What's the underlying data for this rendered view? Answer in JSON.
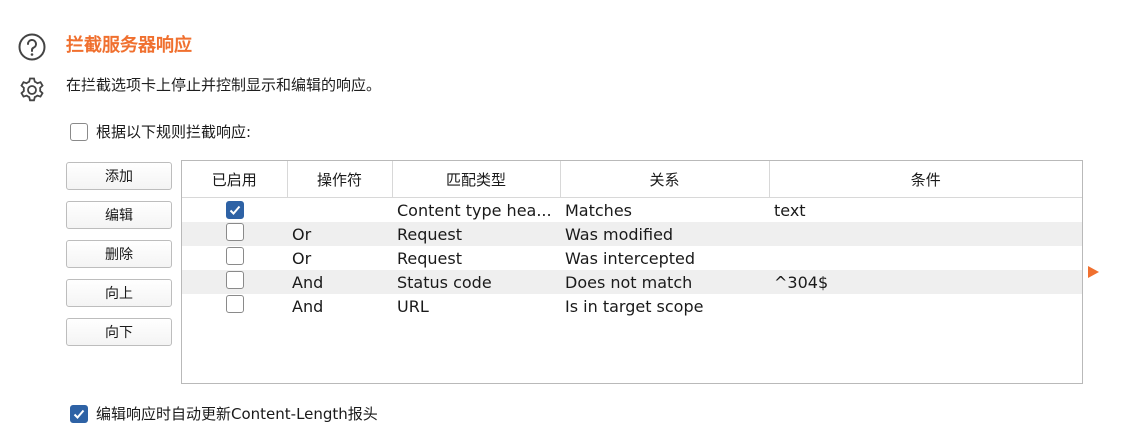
{
  "header": {
    "help_icon": "help-circle-icon",
    "settings_icon": "gear-icon",
    "title": "拦截服务器响应",
    "description": "在拦截选项卡上停止并控制显示和编辑的响应。"
  },
  "intercept_rules_toggle": {
    "label": "根据以下规则拦截响应:",
    "checked": false
  },
  "buttons": {
    "add": "添加",
    "edit": "编辑",
    "remove": "删除",
    "up": "向上",
    "down": "向下"
  },
  "table": {
    "columns": [
      "已启用",
      "操作符",
      "匹配类型",
      "关系",
      "条件"
    ],
    "rows": [
      {
        "enabled": true,
        "operator": "",
        "match_type": "Content type hea...",
        "relationship": "Matches",
        "condition": "text"
      },
      {
        "enabled": false,
        "operator": "Or",
        "match_type": "Request",
        "relationship": "Was modified",
        "condition": ""
      },
      {
        "enabled": false,
        "operator": "Or",
        "match_type": "Request",
        "relationship": "Was intercepted",
        "condition": ""
      },
      {
        "enabled": false,
        "operator": "And",
        "match_type": "Status code",
        "relationship": "Does not match",
        "condition": "^304$"
      },
      {
        "enabled": false,
        "operator": "And",
        "match_type": "URL",
        "relationship": "Is in target scope",
        "condition": ""
      }
    ]
  },
  "auto_update_toggle": {
    "label": "编辑响应时自动更新Content-Length报头",
    "checked": true
  },
  "colors": {
    "accent": "#f0702f",
    "checkbox_checked": "#2e62a5",
    "row_alt": "#efefef"
  }
}
